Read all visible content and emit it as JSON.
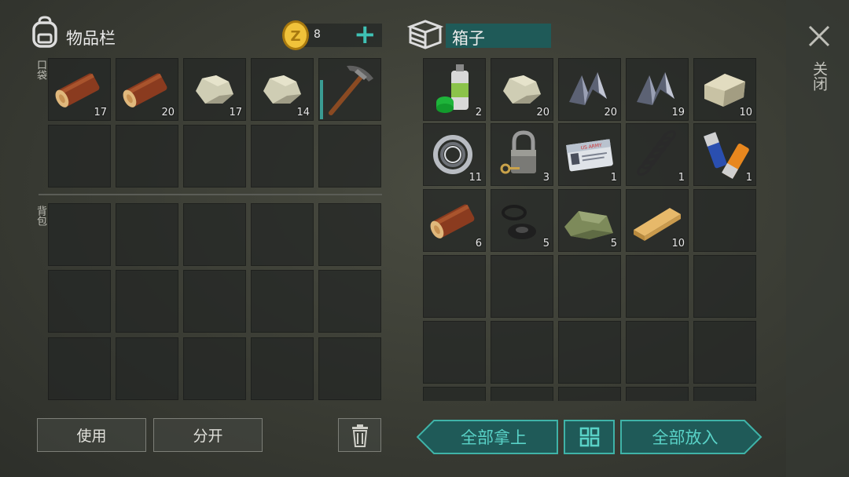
{
  "inventory": {
    "title": "物品栏",
    "pocket_label": "口袋",
    "backpack_label": "背包",
    "coins": "8",
    "add_label": "+",
    "pocket_slots": [
      {
        "item": "log",
        "count": "17"
      },
      {
        "item": "log",
        "count": "20"
      },
      {
        "item": "stone",
        "count": "17"
      },
      {
        "item": "stone",
        "count": "14"
      },
      {
        "item": "pickaxe",
        "count": ""
      }
    ]
  },
  "box": {
    "title": "箱子",
    "slots": [
      {
        "item": "spray-paint",
        "count": "2"
      },
      {
        "item": "stone",
        "count": "20"
      },
      {
        "item": "metal-scrap",
        "count": "20"
      },
      {
        "item": "metal-scrap",
        "count": "19"
      },
      {
        "item": "limestone",
        "count": "10"
      },
      {
        "item": "bearing",
        "count": "11"
      },
      {
        "item": "padlock",
        "count": "3"
      },
      {
        "item": "id-card",
        "count": "1"
      },
      {
        "item": "spring",
        "count": "1"
      },
      {
        "item": "batteries",
        "count": "1"
      },
      {
        "item": "log",
        "count": "6"
      },
      {
        "item": "rubber-rings",
        "count": "5"
      },
      {
        "item": "cloth",
        "count": "5"
      },
      {
        "item": "plank",
        "count": "10"
      }
    ],
    "id_card_text": "US ARMY"
  },
  "buttons": {
    "use": "使用",
    "split": "分开",
    "take_all": "全部拿上",
    "put_all": "全部放入",
    "close": "关闭"
  },
  "colors": {
    "accent": "#59d2c7",
    "teal_dark": "#1f5a58",
    "slot_bg": "#23262a"
  }
}
